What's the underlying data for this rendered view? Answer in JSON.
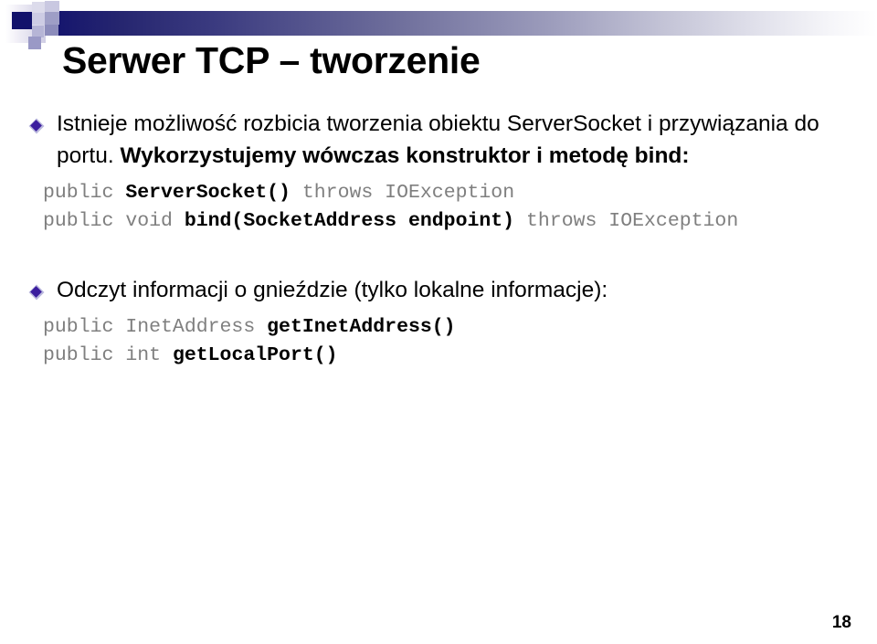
{
  "slide": {
    "title": "Serwer TCP – tworzenie",
    "page_number": "18",
    "accent_colors": {
      "header_gradient_start": "#14146e",
      "header_gradient_end": "#ffffff",
      "bullet_diamond": "#3b1d9e",
      "bullet_diamond_border": "#b9b7dd",
      "code_text": "#8d8d8d",
      "code_emphasis": "#000000"
    },
    "bullets": [
      {
        "icon": "diamond-bullet-icon",
        "text_plain": "Istnieje możliwość rozbicia tworzenia obiektu ServerSocket i przywiązania do portu. Wykorzystujemy wówczas konstruktor i metodę bind:",
        "text_normal": "Istnieje możliwość rozbicia tworzenia obiektu ServerSocket i przywiązania do portu. ",
        "text_bold": "Wykorzystujemy wówczas konstruktor i metodę bind:",
        "code_lines": [
          {
            "prefix": "public ",
            "emphasis": "ServerSocket()",
            "suffix": " throws IOException"
          },
          {
            "prefix": "public void ",
            "emphasis": "bind(SocketAddress endpoint)",
            "suffix": " throws IOException"
          }
        ]
      },
      {
        "icon": "diamond-bullet-icon",
        "text_plain": "Odczyt informacji o gnieździe (tylko lokalne informacje):",
        "text_normal": "Odczyt informacji o gnieździe (tylko lokalne informacje):",
        "text_bold": "",
        "code_lines": [
          {
            "prefix": "public InetAddress ",
            "emphasis": "getInetAddress()",
            "suffix": ""
          },
          {
            "prefix": "public int ",
            "emphasis": "getLocalPort()",
            "suffix": ""
          }
        ]
      }
    ]
  }
}
